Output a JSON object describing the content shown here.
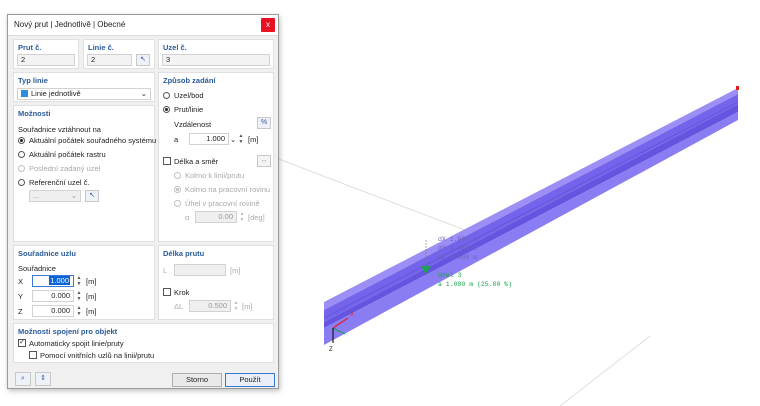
{
  "dialog": {
    "title": "Nový prut | Jednotlivě | Obecné",
    "close_label": "x",
    "ids": {
      "member_label": "Prut č.",
      "member_value": "2",
      "line_label": "Linie č.",
      "line_value": "2",
      "node_label": "Uzel č.",
      "node_value": "3"
    },
    "line_type": {
      "title": "Typ linie",
      "selected": "Linie jednotlivě"
    },
    "options": {
      "title": "Možnosti",
      "coord_ref_label": "Souřadnice vztáhnout na",
      "radios": [
        "Aktuální počátek souřadného systému",
        "Aktuální počátek rastru",
        "Poslední zadaný uzel",
        "Referenční uzel č."
      ],
      "ref_node_value": "..."
    },
    "input_method": {
      "title": "Způsob zadání",
      "radio_node": "Uzel/bod",
      "radio_member": "Prut/linie",
      "distance_label": "Vzdálenost",
      "a_label": "a",
      "a_value": "1.000",
      "a_unit": "[m]",
      "percent_label": "%",
      "length_dir_label": "Délka a směr",
      "perp_line": "Kolmo k linii/prutu",
      "perp_plane": "Kolmo na pracovní rovinu",
      "angle_plane": "Úhel v pracovní rovině",
      "alpha_label": "α",
      "alpha_value": "0.00",
      "alpha_unit": "[deg]"
    },
    "node_coords": {
      "title": "Souřadnice uzlu",
      "sub_label": "Souřadnice",
      "x_label": "X",
      "x_value": "1.000",
      "y_label": "Y",
      "y_value": "0.000",
      "z_label": "Z",
      "z_value": "0.000",
      "unit": "[m]"
    },
    "member_length": {
      "title": "Délka prutu",
      "l_label": "L",
      "l_unit": "[m]",
      "step_label": "Krok",
      "dl_label": "ΔL",
      "dl_value": "0.500",
      "dl_unit": "[m]"
    },
    "connect": {
      "title": "Možnosti spojení pro objekt",
      "auto_label": "Automaticky spojit linie/pruty",
      "inner_label": "Pomocí vnitřních uzlů na linii/prutu"
    },
    "buttons": {
      "cancel": "Storno",
      "apply": "Použít"
    }
  },
  "viewport": {
    "beam_color": "#7e6ff0",
    "annotations": {
      "dx": "dX 1.000 m",
      "dy": "dY 0.000 m",
      "dz": "dZ 0.000 m",
      "node": "Uzel 3",
      "pos": "a 1.000 m (25.00 %)"
    },
    "axis_x": "X",
    "axis_z": "Z"
  }
}
